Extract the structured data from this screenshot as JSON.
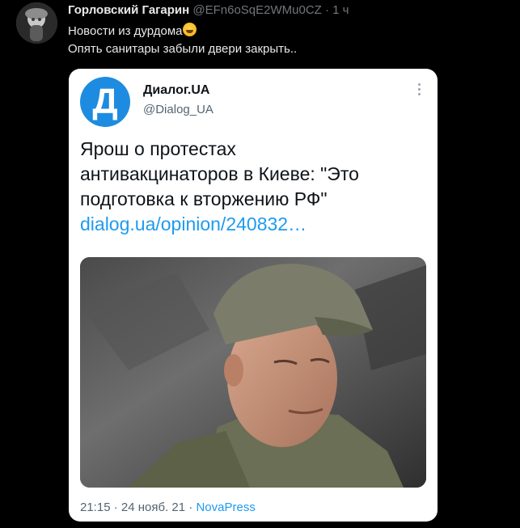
{
  "tweet": {
    "author_name": "Горловский Гагарин",
    "author_handle": "@EFn6oSqE2WMu0CZ",
    "separator": "·",
    "time": "1 ч",
    "text_line1": "Новости из дурдома",
    "text_line2": "Опять санитары забыли двери закрыть..",
    "emoji_name": "laughing-tears-emoji"
  },
  "quoted": {
    "avatar_letter": "Д",
    "avatar_color": "#1d8ce0",
    "name": "Диалог.UA",
    "handle": "@Dialog_UA",
    "headline_line1": "Ярош о протестах",
    "headline_line2": "антивакцинаторов в Киеве: \"Это",
    "headline_line3": "подготовка к вторжению РФ\"",
    "link": "dialog.ua/opinion/240832…",
    "footer_time": "21:15",
    "footer_sep1": "·",
    "footer_date": "24 нояб. 21",
    "footer_sep2": "·",
    "footer_source": "NovaPress"
  },
  "colors": {
    "background": "#000000",
    "link": "#1d9bf0",
    "muted": "#71767b"
  }
}
